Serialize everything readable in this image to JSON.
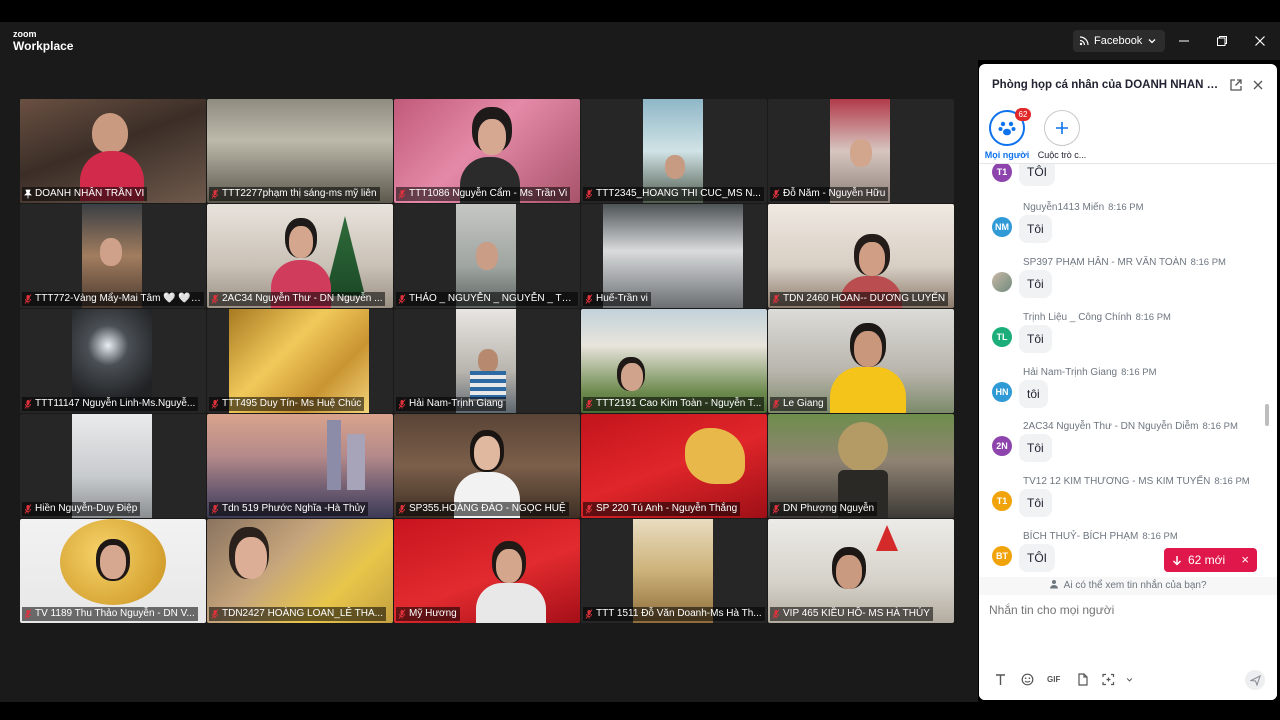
{
  "app": {
    "logo_top": "zoom",
    "logo_bottom": "Workplace"
  },
  "titlebar": {
    "share_button_label": "Facebook"
  },
  "tiles": [
    {
      "name": "DOANH NHÂN TRẦN VI",
      "active": true,
      "muted": false
    },
    {
      "name": "TTT2277phạm thị sáng-ms mỹ liên",
      "muted": true
    },
    {
      "name": "TTT1086 Nguyễn Cẩm - Ms Trần Vi",
      "muted": true
    },
    {
      "name": "TTT2345_HOANG THI CUC_MS N...",
      "muted": true
    },
    {
      "name": "Đỗ Năm - Nguyễn Hữu",
      "muted": true
    },
    {
      "name": "TTT772-Vàng Mẩy-Mai Tâm 🤍 🤍 ...",
      "muted": true
    },
    {
      "name": "2AC34 Nguyễn Thư - DN Nguyễn ...",
      "muted": true
    },
    {
      "name": "THẢO _ NGUYỄN _ NGUYỄN _ TR...",
      "muted": true
    },
    {
      "name": "Huế-Trần vi",
      "muted": true
    },
    {
      "name": "TDN 2460 HOAN-- DƯƠNG LUYẾN",
      "muted": true
    },
    {
      "name": "TTT11147 Nguyễn Linh-Ms.Nguyễ...",
      "muted": true
    },
    {
      "name": "TTT495 Duy Tín- Ms Huệ Chúc",
      "muted": true
    },
    {
      "name": "Hải Nam-Trịnh Giang",
      "muted": true
    },
    {
      "name": "TTT2191 Cao Kim Toàn - Nguyễn T...",
      "muted": true
    },
    {
      "name": "Le Giang",
      "muted": true
    },
    {
      "name": "Hiền Nguyễn-Duy Điệp",
      "muted": true
    },
    {
      "name": "Tdn 519 Phước Nghĩa -Hà Thủy",
      "muted": true
    },
    {
      "name": "SP355.HOÀNG ĐÀO - NGỌC HUỆ",
      "muted": true
    },
    {
      "name": "SP 220 Tú Anh - Nguyễn Thắng",
      "muted": true
    },
    {
      "name": "DN Phượng Nguyễn",
      "muted": true
    },
    {
      "name": "TV 1189 Thu Thảo Nguyễn - DN V...",
      "muted": true
    },
    {
      "name": "TDN2427 HOÀNG LOAN_LÊ THA...",
      "muted": true
    },
    {
      "name": "Mỹ Hương",
      "muted": true
    },
    {
      "name": "TTT 1511 Đỗ Văn Doanh-Ms Hà Th...",
      "muted": true
    },
    {
      "name": "VIP 465  KIỀU HỒ- MS HÀ THỦY",
      "muted": true
    }
  ],
  "chat": {
    "title": "Phòng họp cá nhân của DOANH NHÂN TRẦ...",
    "tabs": [
      {
        "label": "Mọi người",
        "badge": "62"
      },
      {
        "label": "Cuộc trò c..."
      }
    ],
    "messages": [
      {
        "initials": "T1",
        "color": "#8e44ad",
        "sender": "",
        "time": "",
        "text": "TÔI"
      },
      {
        "initials": "NM",
        "color": "#2f9ad6",
        "sender": "Nguyễn1413 Miến",
        "time": "8:16 PM",
        "text": "Tôi"
      },
      {
        "initials": "",
        "color": "#7d8c8a",
        "sender": "SP397 PHẠM HÂN - MR VĂN TOÀN",
        "time": "8:16 PM",
        "text": "Tôi"
      },
      {
        "initials": "TL",
        "color": "#1cae7a",
        "sender": "Trịnh Liệu _ Công Chính",
        "time": "8:16 PM",
        "text": "Tôi"
      },
      {
        "initials": "HN",
        "color": "#2f9ad6",
        "sender": "Hải Nam-Trịnh Giang",
        "time": "8:16 PM",
        "text": "tôi"
      },
      {
        "initials": "2N",
        "color": "#8e44ad",
        "sender": "2AC34 Nguyễn Thư - DN Nguyễn Diễm",
        "time": "8:16 PM",
        "text": "Tôi"
      },
      {
        "initials": "T1",
        "color": "#f0a30a",
        "sender": "TV12 12 KIM THƯƠNG - MS KIM TUYẾN",
        "time": "8:16 PM",
        "text": "Tôi"
      },
      {
        "initials": "BT",
        "color": "#f0a30a",
        "sender": "BÍCH THUỶ- BÍCH PHẠM",
        "time": "8:16 PM",
        "text": "TÔI"
      }
    ],
    "new_messages": "62 mới",
    "visibility_note": "Ai có thể xem tin nhắn của bạn?",
    "compose_placeholder": "Nhắn tin cho mọi người",
    "gif_label": "GIF"
  }
}
